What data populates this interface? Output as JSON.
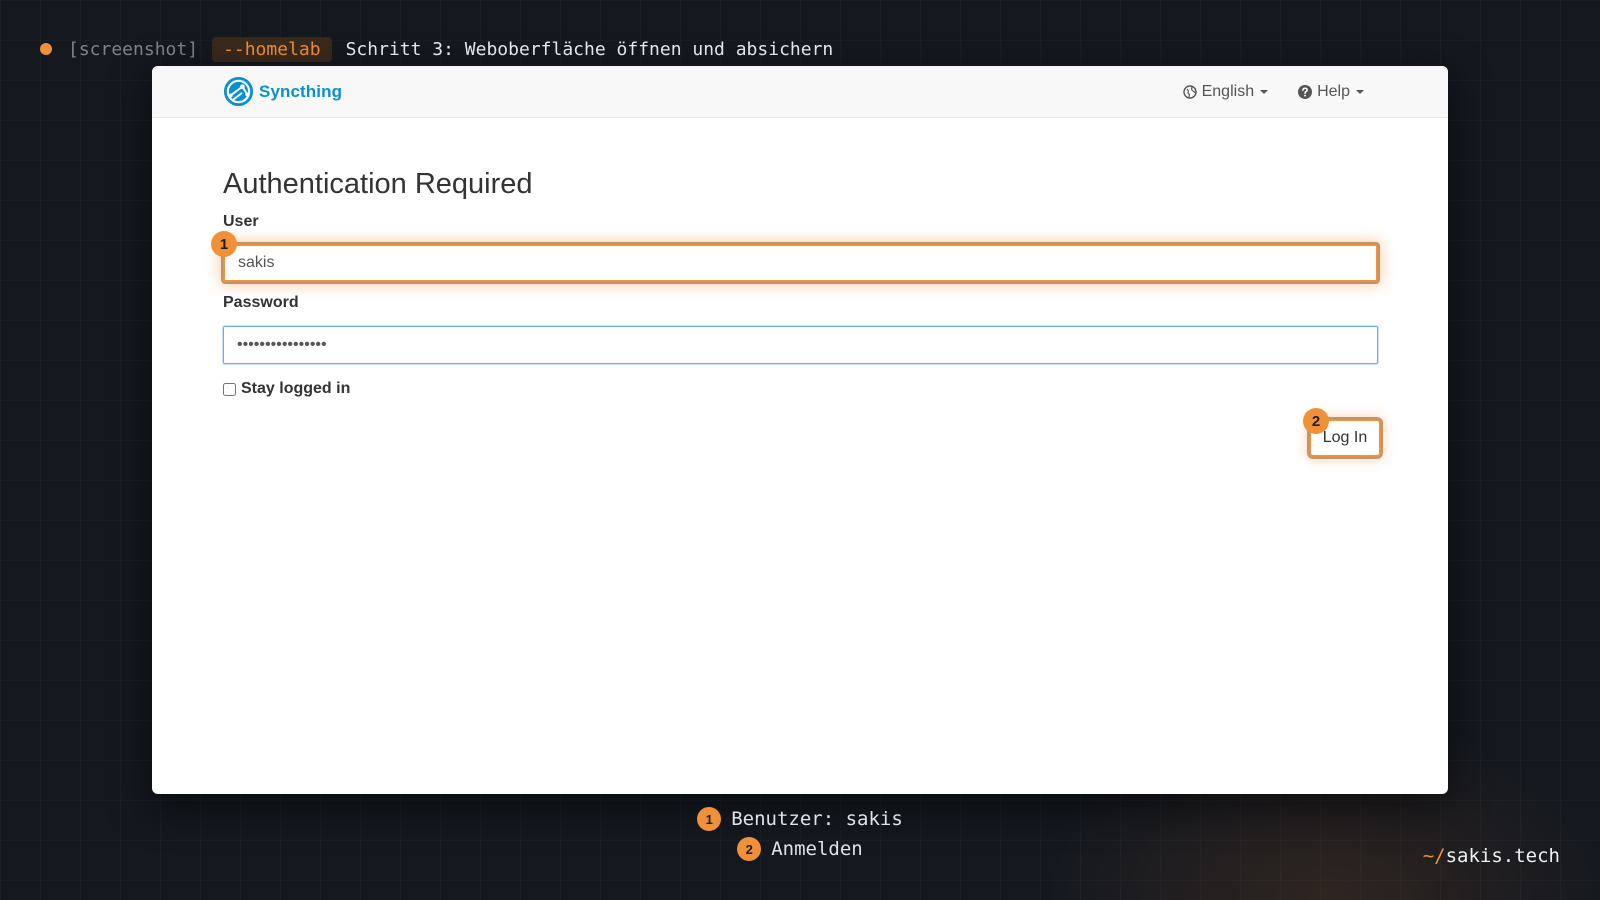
{
  "caption": {
    "tag": "[screenshot]",
    "flag": "--homelab",
    "title": "Schritt 3: Weboberfläche öffnen und absichern"
  },
  "app": {
    "brand_name": "Syncthing",
    "nav": {
      "language_label": "English",
      "help_label": "Help"
    }
  },
  "auth": {
    "title": "Authentication Required",
    "user_label": "User",
    "user_value": "sakis",
    "password_label": "Password",
    "password_value": "••••••••••••••••",
    "stay_logged_in_label": "Stay logged in",
    "stay_logged_in_checked": false,
    "login_button_label": "Log In"
  },
  "badges": {
    "one": "1",
    "two": "2"
  },
  "legend": [
    {
      "num": "1",
      "text": "Benutzer: sakis"
    },
    {
      "num": "2",
      "text": "Anmelden"
    }
  ],
  "footer": {
    "prefix": "~/",
    "name": "sakis.tech"
  },
  "colors": {
    "accent": "#f28f3b",
    "brand": "#0891d1",
    "background": "#14181f",
    "focus_blue": "#66afe9"
  }
}
